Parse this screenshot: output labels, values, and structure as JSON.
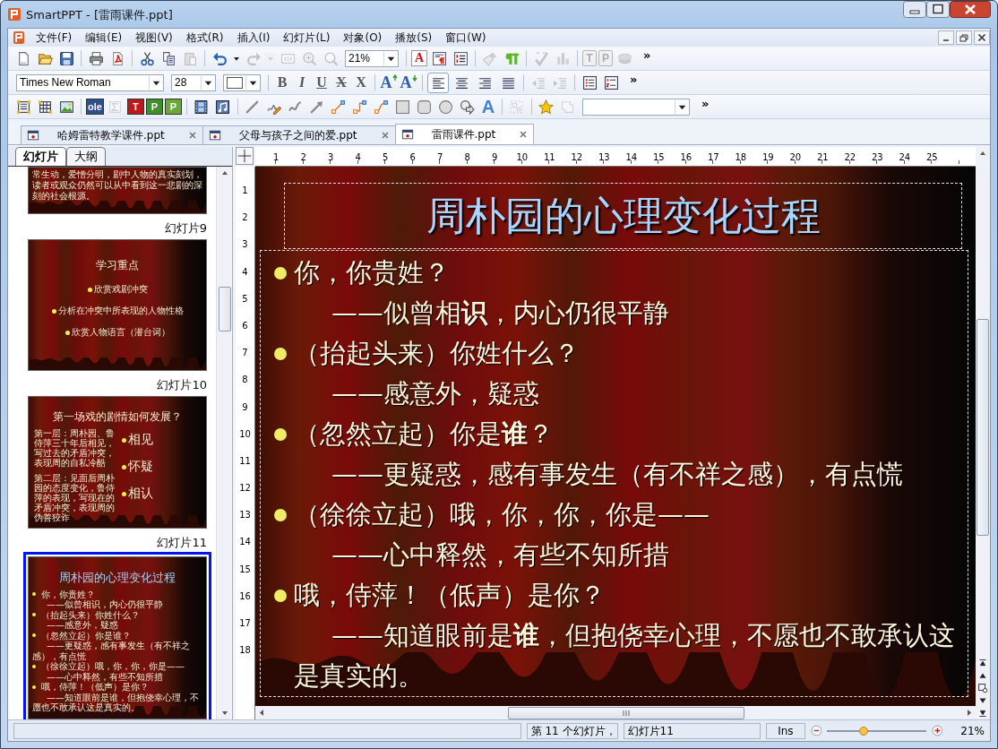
{
  "window": {
    "title": "SmartPPT - [雷雨课件.ppt]"
  },
  "menu": [
    "文件(F)",
    "编辑(E)",
    "视图(V)",
    "格式(R)",
    "插入(I)",
    "幻灯片(L)",
    "对象(O)",
    "播放(S)",
    "窗口(W)"
  ],
  "toolbar_standard": [
    {
      "kind": "new",
      "disabled": false
    },
    {
      "kind": "open",
      "disabled": false
    },
    {
      "kind": "save",
      "disabled": false
    },
    {
      "kind": "sep"
    },
    {
      "kind": "print",
      "disabled": false
    },
    {
      "kind": "pdf",
      "disabled": false
    },
    {
      "kind": "sep"
    },
    {
      "kind": "cut",
      "disabled": false
    },
    {
      "kind": "copy",
      "disabled": false
    },
    {
      "kind": "paste",
      "disabled": true
    },
    {
      "kind": "sep"
    },
    {
      "kind": "undo",
      "disabled": false
    },
    {
      "kind": "caret",
      "disabled": false
    },
    {
      "kind": "redo",
      "disabled": true
    },
    {
      "kind": "caret",
      "disabled": true
    },
    {
      "kind": "actual",
      "disabled": true
    },
    {
      "kind": "zoomfit",
      "disabled": true
    },
    {
      "kind": "zoom",
      "disabled": true
    },
    {
      "kind": "zoomcombo",
      "value": "21%"
    },
    {
      "kind": "sep"
    },
    {
      "kind": "lettercolor",
      "glyph": "A",
      "disabled": false
    },
    {
      "kind": "paragraph",
      "disabled": false
    },
    {
      "kind": "outline",
      "disabled": false
    },
    {
      "kind": "sep"
    },
    {
      "kind": "brush",
      "disabled": true
    },
    {
      "kind": "pilcrow",
      "disabled": false
    },
    {
      "kind": "sep"
    },
    {
      "kind": "spell",
      "disabled": true
    },
    {
      "kind": "chart",
      "disabled": true
    },
    {
      "kind": "sep"
    },
    {
      "kind": "boxletter",
      "glyph": "T",
      "disabled": true
    },
    {
      "kind": "boxletter",
      "glyph": "P",
      "disabled": true
    },
    {
      "kind": "stack",
      "disabled": true
    },
    {
      "kind": "more",
      "glyph": "»"
    }
  ],
  "toolbar_format": [
    {
      "kind": "fontcombo",
      "value": "Times New Roman"
    },
    {
      "kind": "sizecombo",
      "value": "28"
    },
    {
      "kind": "colorcombo"
    },
    {
      "kind": "sep"
    },
    {
      "kind": "bold",
      "glyph": "B",
      "disabled": false
    },
    {
      "kind": "italic",
      "glyph": "I",
      "disabled": false
    },
    {
      "kind": "underline",
      "glyph": "U",
      "disabled": false
    },
    {
      "kind": "strike",
      "glyph": "X",
      "disabled": false
    },
    {
      "kind": "cross",
      "glyph": "X",
      "disabled": false
    },
    {
      "kind": "sep"
    },
    {
      "kind": "grow",
      "glyph": "A",
      "disabled": false
    },
    {
      "kind": "shrink",
      "glyph": "A",
      "disabled": false
    },
    {
      "kind": "sep"
    },
    {
      "kind": "alignleft",
      "selected": true
    },
    {
      "kind": "aligncenter",
      "selected": false
    },
    {
      "kind": "alignright",
      "selected": false
    },
    {
      "kind": "justify",
      "selected": false
    },
    {
      "kind": "sep"
    },
    {
      "kind": "outdent",
      "disabled": true
    },
    {
      "kind": "indent",
      "disabled": true
    },
    {
      "kind": "sep"
    },
    {
      "kind": "bullets",
      "disabled": false
    },
    {
      "kind": "numbering",
      "disabled": false
    },
    {
      "kind": "more",
      "glyph": "»"
    }
  ],
  "toolbar_drawing": [
    {
      "kind": "textbox",
      "disabled": false
    },
    {
      "kind": "table",
      "disabled": false
    },
    {
      "kind": "picture",
      "disabled": false
    },
    {
      "kind": "sep"
    },
    {
      "kind": "tile",
      "glyph": "ole",
      "color": "#2d4f8f",
      "disabled": false
    },
    {
      "kind": "formula",
      "disabled": true
    },
    {
      "kind": "tile",
      "glyph": "T",
      "color": "#c0171b",
      "disabled": false
    },
    {
      "kind": "tile",
      "glyph": "P",
      "color": "#3f8f2a",
      "disabled": false
    },
    {
      "kind": "tile",
      "glyph": "P",
      "color": "#6aa83a",
      "disabled": false
    },
    {
      "kind": "sep"
    },
    {
      "kind": "film",
      "disabled": false
    },
    {
      "kind": "music",
      "disabled": false
    },
    {
      "kind": "sep"
    },
    {
      "kind": "line",
      "disabled": false
    },
    {
      "kind": "pencil",
      "disabled": false
    },
    {
      "kind": "curve",
      "disabled": false
    },
    {
      "kind": "arrow",
      "disabled": false
    },
    {
      "kind": "connector",
      "disabled": false
    },
    {
      "kind": "elbow",
      "disabled": false
    },
    {
      "kind": "curveconn",
      "disabled": false
    },
    {
      "kind": "rect",
      "disabled": false
    },
    {
      "kind": "roundrect",
      "disabled": false
    },
    {
      "kind": "ellipse",
      "disabled": false
    },
    {
      "kind": "callout",
      "disabled": false
    },
    {
      "kind": "wordart",
      "glyph": "A",
      "disabled": false
    },
    {
      "kind": "sep"
    },
    {
      "kind": "group",
      "disabled": true
    },
    {
      "kind": "sep"
    },
    {
      "kind": "star",
      "disabled": false
    },
    {
      "kind": "ungroup",
      "disabled": true
    },
    {
      "kind": "stylecombo"
    },
    {
      "kind": "more",
      "glyph": "»"
    }
  ],
  "document_tabs": [
    {
      "label": "哈姆雷特教学课件.ppt",
      "selected": false
    },
    {
      "label": "父母与孩子之间的爱.ppt",
      "selected": false
    },
    {
      "label": "雷雨课件.ppt",
      "selected": true
    }
  ],
  "panel_tabs": [
    {
      "label": "幻灯片",
      "selected": true
    },
    {
      "label": "大纲",
      "selected": false
    }
  ],
  "thumbnails": [
    {
      "kind": "partial",
      "selected": false,
      "text": "常生动，爱憎分明，剧中人物的真实刻划，读者或观众仍然可以从中看到这一悲剧的深刻的社会根源。"
    },
    {
      "kind": "list",
      "label": "幻灯片9",
      "selected": false,
      "title": "学习重点",
      "bullets": [
        "欣赏戏剧冲突",
        "分析在冲突中所表现的人物性格",
        "欣赏人物语言（潜台词）"
      ]
    },
    {
      "kind": "split",
      "label": "幻灯片10",
      "selected": false,
      "title": "第一场戏的剧情如何发展？",
      "notes": [
        "第一层：周朴园、鲁侍萍三十年后相见，写过去的矛盾冲突，表现周的自私冷酷",
        "第二层：见面后周朴园的态度变化，鲁侍萍的表现，写现在的矛盾冲突，表现周的伪善狡诈"
      ],
      "bullets": [
        "相见",
        "怀疑",
        "相认"
      ]
    },
    {
      "kind": "detail",
      "label": "幻灯片11",
      "selected": true,
      "title": "周朴园的心理变化过程",
      "lines": [
        {
          "kind": "bullet",
          "text": "你，你贵姓？"
        },
        {
          "kind": "sub",
          "text": "——似曾相识，内心仍很平静"
        },
        {
          "kind": "bullet",
          "text": "（抬起头来）你姓什么？"
        },
        {
          "kind": "sub",
          "text": "——感意外，疑惑"
        },
        {
          "kind": "bullet",
          "text": "（忽然立起）你是谁？"
        },
        {
          "kind": "sub",
          "text": "——更疑惑，感有事发生（有不祥之感），有点慌"
        },
        {
          "kind": "bullet",
          "text": "（徐徐立起）哦，你，你，你是——"
        },
        {
          "kind": "sub",
          "text": "——心中释然，有些不知所措"
        },
        {
          "kind": "bullet",
          "text": "哦，侍萍！（低声）是你？"
        },
        {
          "kind": "sub",
          "text": "——知道眼前是谁，但抱侥幸心理，不愿也不敢承认这是真实的。"
        }
      ]
    }
  ],
  "ruler_horizontal": [
    "1",
    "2",
    "3",
    "4",
    "5",
    "6",
    "7",
    "8",
    "9",
    "10",
    "11",
    "12",
    "13",
    "14",
    "15",
    "16",
    "17",
    "18",
    "19",
    "20",
    "21",
    "22",
    "23",
    "24",
    "25"
  ],
  "ruler_vertical": [
    "1",
    "2",
    "3",
    "4",
    "5",
    "6",
    "7",
    "8",
    "9",
    "10",
    "11",
    "12",
    "13",
    "14",
    "15",
    "16",
    "17",
    "18"
  ],
  "slide": {
    "title": "周朴园的心理变化过程",
    "lines": [
      {
        "kind": "bullet",
        "text": "你，你贵姓？"
      },
      {
        "kind": "sub",
        "text": "——似曾相**识**，内心仍很平静"
      },
      {
        "kind": "bullet",
        "text": "（抬起头来）你姓什么？"
      },
      {
        "kind": "sub",
        "text": "——感意外，疑惑"
      },
      {
        "kind": "bullet",
        "text": "（忽然立起）你是**谁**？"
      },
      {
        "kind": "sub",
        "text": "——更疑惑，感有事发生（有不祥之感），有点慌"
      },
      {
        "kind": "bullet",
        "text": "（徐徐立起）哦，你，你，你是——"
      },
      {
        "kind": "sub",
        "text": "——心中释然，有些不知所措"
      },
      {
        "kind": "bullet",
        "text": "哦，侍萍！（低声）是你？"
      },
      {
        "kind": "sub",
        "text": "——知道眼前是**谁**，但抱侥幸心理，不愿也不敢承认这是真实的。"
      }
    ]
  },
  "status_bar": {
    "panels": [
      "第 11 个幻灯片，",
      "幻灯片11",
      "Ins"
    ],
    "zoom": {
      "level": 0.37,
      "reading": "21%"
    }
  }
}
